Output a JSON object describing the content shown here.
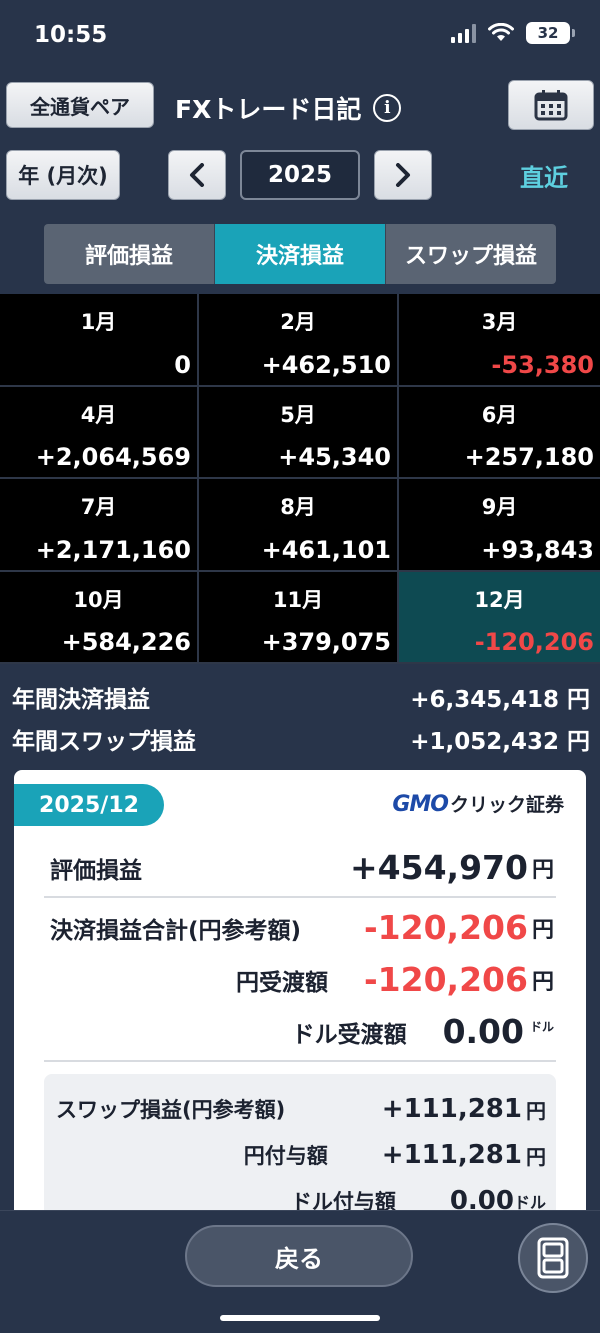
{
  "status_bar": {
    "time": "10:55",
    "battery": "32"
  },
  "header": {
    "currency_button": "全通貨ペア",
    "title": "FXトレード日記",
    "calendar_icon": "calendar-icon"
  },
  "nav": {
    "period_button": "年 (月次)",
    "prev": "<",
    "year": "2025",
    "next": ">",
    "recent": "直近"
  },
  "tabs": [
    {
      "label": "評価損益",
      "active": false
    },
    {
      "label": "決済損益",
      "active": true
    },
    {
      "label": "スワップ損益",
      "active": false
    }
  ],
  "months": [
    {
      "month": "1月",
      "value": "0",
      "negative": false
    },
    {
      "month": "2月",
      "value": "+462,510",
      "negative": false
    },
    {
      "month": "3月",
      "value": "-53,380",
      "negative": true
    },
    {
      "month": "4月",
      "value": "+2,064,569",
      "negative": false
    },
    {
      "month": "5月",
      "value": "+45,340",
      "negative": false
    },
    {
      "month": "6月",
      "value": "+257,180",
      "negative": false
    },
    {
      "month": "7月",
      "value": "+2,171,160",
      "negative": false
    },
    {
      "month": "8月",
      "value": "+461,101",
      "negative": false
    },
    {
      "month": "9月",
      "value": "+93,843",
      "negative": false
    },
    {
      "month": "10月",
      "value": "+584,226",
      "negative": false
    },
    {
      "month": "11月",
      "value": "+379,075",
      "negative": false
    },
    {
      "month": "12月",
      "value": "-120,206",
      "negative": true,
      "selected": true
    }
  ],
  "summary": {
    "settled_label": "年間決済損益",
    "settled_value": "+6,345,418 円",
    "swap_label": "年間スワップ損益",
    "swap_value": "+1,052,432 円"
  },
  "detail": {
    "period": "2025/12",
    "logo_gmo": "GMO",
    "logo_text": "クリック証券",
    "unrealized_label": "評価損益",
    "unrealized_value": "+454,970",
    "unrealized_unit": "円",
    "settled_total_label": "決済損益合計(円参考額)",
    "settled_total_value": "-120,206",
    "settled_total_unit": "円",
    "yen_delivery_label": "円受渡額",
    "yen_delivery_value": "-120,206",
    "yen_delivery_unit": "円",
    "usd_delivery_label": "ドル受渡額",
    "usd_delivery_value": "0.00",
    "usd_delivery_unit": "ドル",
    "swap_label": "スワップ損益(円参考額)",
    "swap_value": "+111,281",
    "swap_unit": "円",
    "yen_grant_label": "円付与額",
    "yen_grant_value": "+111,281",
    "yen_grant_unit": "円",
    "usd_grant_label": "ドル付与額",
    "usd_grant_value": "0.00",
    "usd_grant_unit": "ドル"
  },
  "footer": {
    "back_button": "戻る"
  },
  "colors": {
    "background": "#28344a",
    "accent": "#1aa3b8",
    "negative": "#f04848",
    "positive": "#ffffff"
  }
}
